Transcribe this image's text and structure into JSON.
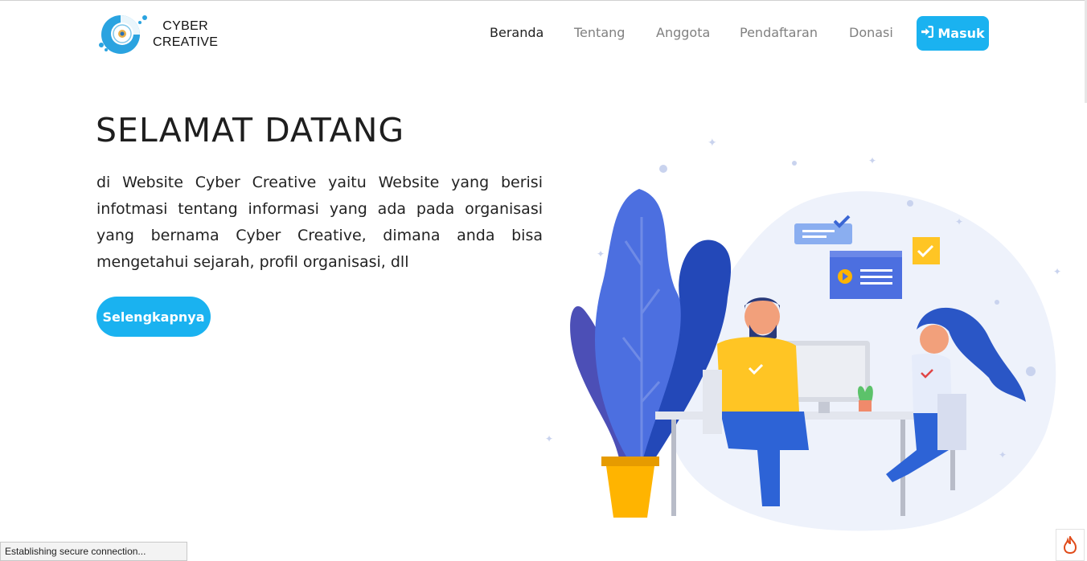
{
  "brand": {
    "line1": "CYBER",
    "line2": "CREATIVE",
    "logo": "cyber-creative-logo"
  },
  "nav": {
    "items": [
      {
        "label": "Beranda",
        "active": true
      },
      {
        "label": "Tentang",
        "active": false
      },
      {
        "label": "Anggota",
        "active": false
      },
      {
        "label": "Pendaftaran",
        "active": false
      },
      {
        "label": "Donasi",
        "active": false
      }
    ],
    "login_label": "Masuk",
    "login_icon": "sign-in-icon"
  },
  "hero": {
    "title": "SELAMAT DATANG",
    "text": "di Website Cyber Creative yaitu Website yang berisi infotmasi tentang informasi yang ada pada organisasi yang bernama Cyber Creative, dimana anda bisa mengetahui sejarah, profil organisasi, dll",
    "cta_label": "Selengkapnya"
  },
  "status_bar": {
    "text": "Establishing secure connection..."
  },
  "colors": {
    "accent": "#1ab2f0",
    "active_nav": "#222222",
    "inactive_nav": "#808080"
  }
}
